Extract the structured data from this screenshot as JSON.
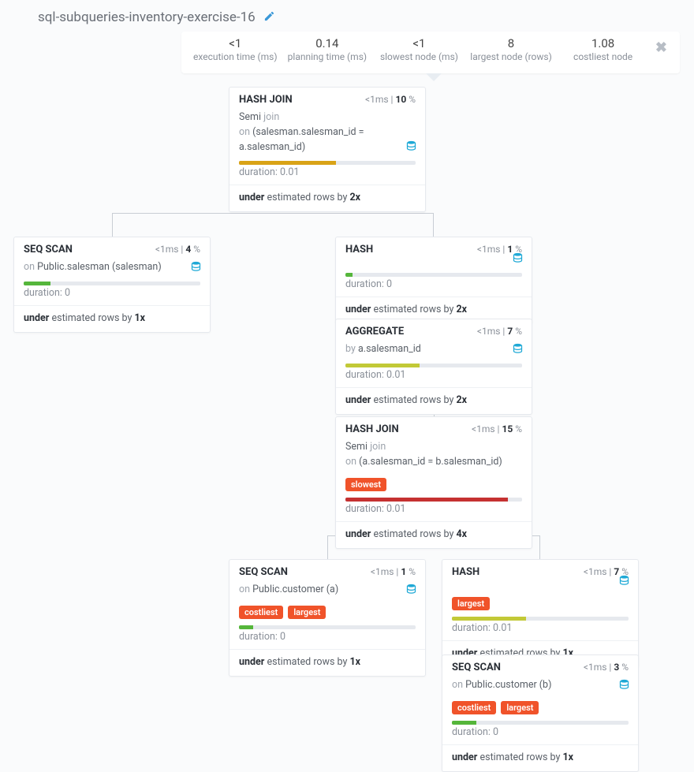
{
  "page": {
    "title": "sql-subqueries-inventory-exercise-16"
  },
  "stats": {
    "exec_time_val": "<1",
    "exec_time_lbl": "execution time (ms)",
    "plan_time_val": "0.14",
    "plan_time_lbl": "planning time (ms)",
    "slowest_val": "<1",
    "slowest_lbl": "slowest node (ms)",
    "largest_val": "8",
    "largest_lbl": "largest node (rows)",
    "costliest_val": "1.08",
    "costliest_lbl": "costliest node"
  },
  "nodes": {
    "hashjoin1": {
      "title": "HASH JOIN",
      "ms": "<1ms",
      "pct": "10",
      "line1a": "Semi",
      "line1b": "join",
      "line2a": "on",
      "line2b": "(salesman.salesman_id = a.salesman_id)",
      "bar_color": "#d9a317",
      "bar_pct": 55,
      "dur": "duration: 0.01",
      "est_a": "under",
      "est_b": "estimated rows by",
      "est_c": "2x"
    },
    "seqscan_salesman": {
      "title": "SEQ SCAN",
      "ms": "<1ms",
      "pct": "4",
      "line1a": "on",
      "line1b": "Public.salesman (salesman)",
      "bar_color": "#55b63b",
      "bar_pct": 15,
      "dur": "duration: 0",
      "est_a": "under",
      "est_b": "estimated rows by",
      "est_c": "1x"
    },
    "hash1": {
      "title": "HASH",
      "ms": "<1ms",
      "pct": "1",
      "bar_color": "#55b63b",
      "bar_pct": 4,
      "dur": "duration: 0",
      "est_a": "under",
      "est_b": "estimated rows by",
      "est_c": "2x"
    },
    "aggregate": {
      "title": "AGGREGATE",
      "ms": "<1ms",
      "pct": "7",
      "line1a": "by",
      "line1b": "a.salesman_id",
      "bar_color": "#c2c937",
      "bar_pct": 42,
      "dur": "duration: 0.01",
      "est_a": "under",
      "est_b": "estimated rows by",
      "est_c": "2x"
    },
    "hashjoin2": {
      "title": "HASH JOIN",
      "ms": "<1ms",
      "pct": "15",
      "line1a": "Semi",
      "line1b": "join",
      "line2a": "on",
      "line2b": "(a.salesman_id = b.salesman_id)",
      "badge1": "slowest",
      "bar_color": "#c53131",
      "bar_pct": 92,
      "dur": "duration: 0.01",
      "est_a": "under",
      "est_b": "estimated rows by",
      "est_c": "4x"
    },
    "seqscan_cust_a": {
      "title": "SEQ SCAN",
      "ms": "<1ms",
      "pct": "1",
      "line1a": "on",
      "line1b": "Public.customer (a)",
      "badge1": "costliest",
      "badge2": "largest",
      "bar_color": "#55b63b",
      "bar_pct": 8,
      "dur": "duration: 0",
      "est_a": "under",
      "est_b": "estimated rows by",
      "est_c": "1x"
    },
    "hash2": {
      "title": "HASH",
      "ms": "<1ms",
      "pct": "7",
      "badge1": "largest",
      "bar_color": "#c2c937",
      "bar_pct": 42,
      "dur": "duration: 0.01",
      "est_a": "under",
      "est_b": "estimated rows by",
      "est_c": "1x"
    },
    "seqscan_cust_b": {
      "title": "SEQ SCAN",
      "ms": "<1ms",
      "pct": "3",
      "line1a": "on",
      "line1b": "Public.customer (b)",
      "badge1": "costliest",
      "badge2": "largest",
      "bar_color": "#55b63b",
      "bar_pct": 14,
      "dur": "duration: 0",
      "est_a": "under",
      "est_b": "estimated rows by",
      "est_c": "1x"
    }
  },
  "ui": {
    "pct_sym": "%",
    "sep": " | "
  }
}
